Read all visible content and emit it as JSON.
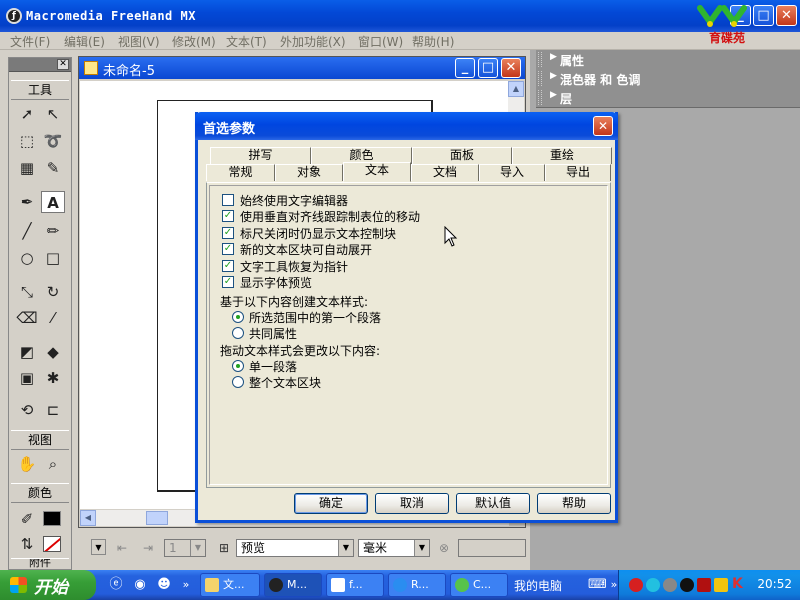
{
  "app": {
    "title": "Macromedia FreeHand MX",
    "logo_text": "育碟苑"
  },
  "menu": {
    "items": [
      "文件(F)",
      "编辑(E)",
      "视图(V)",
      "修改(M)",
      "文本(T)",
      "外加功能(X)",
      "窗口(W)",
      "帮助(H)"
    ]
  },
  "toolbox": {
    "title": "工具",
    "view_label": "视图",
    "color_label": "颜色",
    "bottom_label": "附件"
  },
  "document": {
    "title": "未命名-5"
  },
  "statusbar": {
    "page_number": "1",
    "view_mode": "预览",
    "units": "毫米"
  },
  "panels": [
    {
      "label": "属性"
    },
    {
      "label": "混色器 和 色调"
    },
    {
      "label": "层"
    }
  ],
  "dialog": {
    "title": "首选参数",
    "tabs_top": [
      "拼写",
      "颜色",
      "面板",
      "重绘"
    ],
    "tabs_bottom": [
      "常规",
      "对象",
      "文本",
      "文档",
      "导入",
      "导出"
    ],
    "active_tab": "文本",
    "checkboxes": [
      {
        "label": "始终使用文字编辑器",
        "checked": false
      },
      {
        "label": "使用垂直对齐线跟踪制表位的移动",
        "checked": true
      },
      {
        "label": "标尺关闭时仍显示文本控制块",
        "checked": true
      },
      {
        "label": "新的文本区块可自动展开",
        "checked": true
      },
      {
        "label": "文字工具恢复为指针",
        "checked": true
      },
      {
        "label": "显示字体预览",
        "checked": true
      }
    ],
    "group1": {
      "label": "基于以下内容创建文本样式:",
      "options": [
        {
          "label": "所选范围中的第一个段落",
          "selected": true
        },
        {
          "label": "共同属性",
          "selected": false
        }
      ]
    },
    "group2": {
      "label": "拖动文本样式会更改以下内容:",
      "options": [
        {
          "label": "单一段落",
          "selected": true
        },
        {
          "label": "整个文本区块",
          "selected": false
        }
      ]
    },
    "buttons": {
      "ok": "确定",
      "cancel": "取消",
      "defaults": "默认值",
      "help": "帮助"
    }
  },
  "taskbar": {
    "start_label": "开始",
    "tasks": [
      "文...",
      "M...",
      "f...",
      "R...",
      "C..."
    ],
    "my_computer": "我的电脑",
    "clock": "20:52"
  }
}
